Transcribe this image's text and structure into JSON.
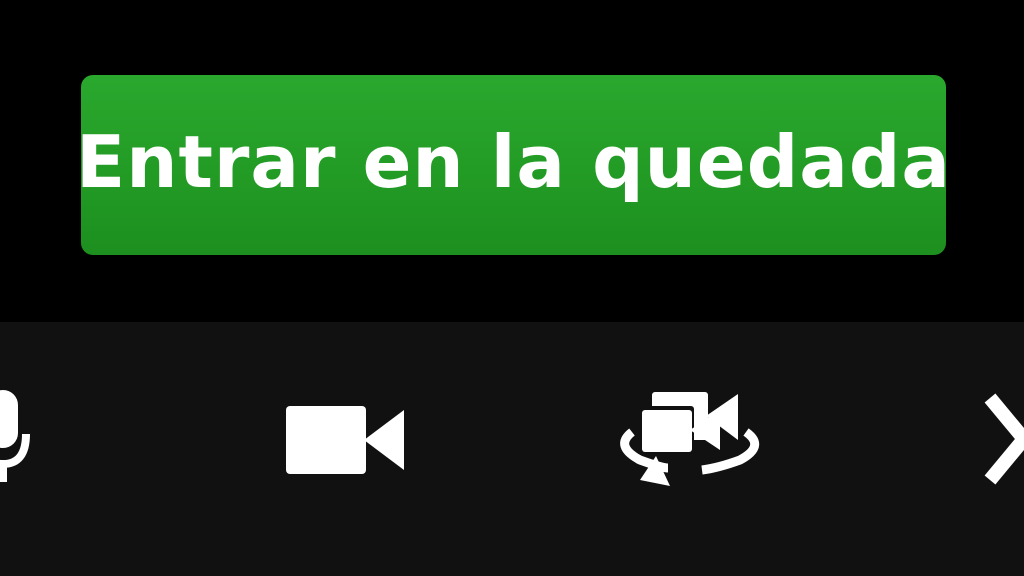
{
  "join": {
    "label": "Entrar en la quedada"
  },
  "toolbar": {
    "items": [
      {
        "icon": "microphone-icon"
      },
      {
        "icon": "video-camera-icon"
      },
      {
        "icon": "switch-camera-icon"
      },
      {
        "icon": "close-icon"
      }
    ]
  },
  "colors": {
    "background": "#000000",
    "toolbar_background": "#111111",
    "button_green": "#229a24",
    "icon_white": "#ffffff"
  }
}
